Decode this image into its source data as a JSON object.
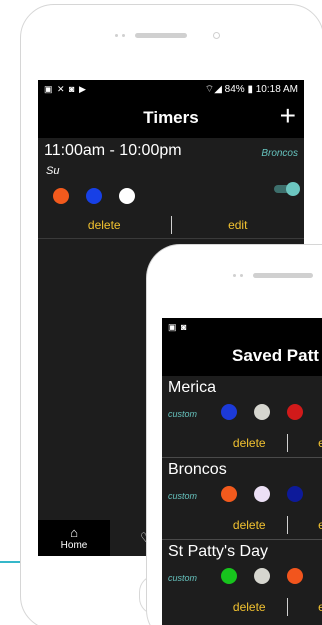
{
  "colors": {
    "accent_yellow": "#f2c230",
    "accent_teal": "#66c2bd",
    "screen_bg": "#1d1d1d",
    "bar_bg": "#000000"
  },
  "back_phone": {
    "status": {
      "left_icons": "▣ ✕ ◙ ▶",
      "right_text": "⌔◢ 84% ▮ 10:18 AM"
    },
    "header": {
      "title": "Timers",
      "add_icon": "+"
    },
    "timer": {
      "time_range": "11:00am - 10:00pm",
      "pattern": "Broncos",
      "days": "Su",
      "colors": [
        "#f25a1d",
        "#1740e6",
        "#ffffff"
      ],
      "enabled": true,
      "delete_label": "delete",
      "edit_label": "edit"
    },
    "tabs": [
      {
        "label": "Home",
        "icon": "home-icon",
        "glyph": "⌂"
      },
      {
        "label": "",
        "icon": "heart-icon",
        "glyph": "♡"
      }
    ]
  },
  "front_phone": {
    "status": {
      "left_icons": "▣ ◙"
    },
    "header": {
      "title": "Saved Patt"
    },
    "patterns": [
      {
        "name": "Merica",
        "type": "custom",
        "colors": [
          "#1c3ad8",
          "#d6d6cf",
          "#d11a1a"
        ],
        "delete_label": "delete",
        "edit_label": "ed"
      },
      {
        "name": "Broncos",
        "type": "custom",
        "colors": [
          "#f25a1d",
          "#ece0f5",
          "#0d1a9a"
        ],
        "delete_label": "delete",
        "edit_label": "ed"
      },
      {
        "name": "St Patty's Day",
        "type": "custom",
        "colors": [
          "#17c41d",
          "#d6d6cf",
          "#f2551d"
        ],
        "delete_label": "delete",
        "edit_label": "ed"
      }
    ]
  }
}
